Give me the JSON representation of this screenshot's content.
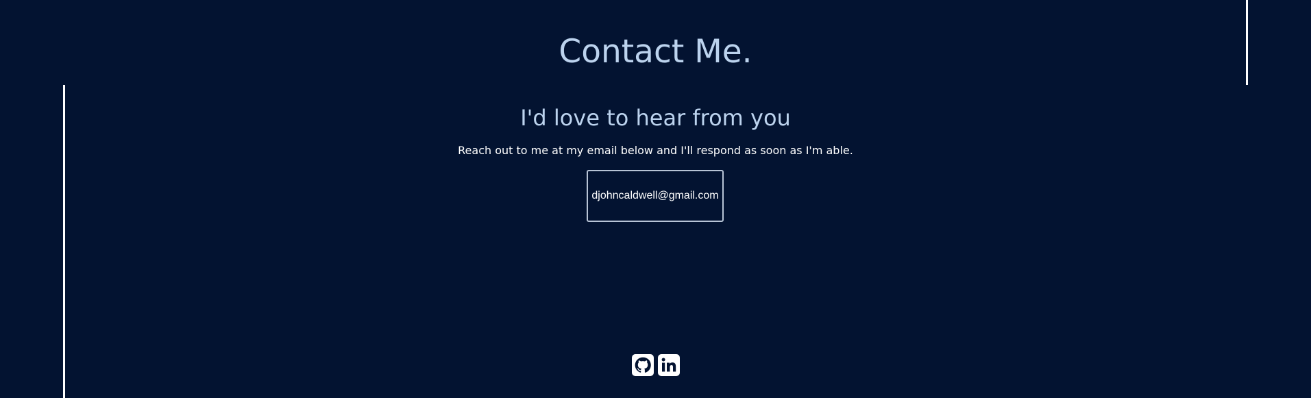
{
  "contact": {
    "title": "Contact Me.",
    "subtitle": "I'd love to hear from you",
    "note": "Reach out to me at my email below and I'll respond as soon as I'm able.",
    "email": "djohncaldwell@gmail.com"
  },
  "social": {
    "icons": [
      "github-icon",
      "linkedin-icon"
    ]
  },
  "colors": {
    "background": "#031331",
    "heading": "#bcd3ee",
    "text": "#ffffff",
    "button_border": "#b8c4d6"
  }
}
